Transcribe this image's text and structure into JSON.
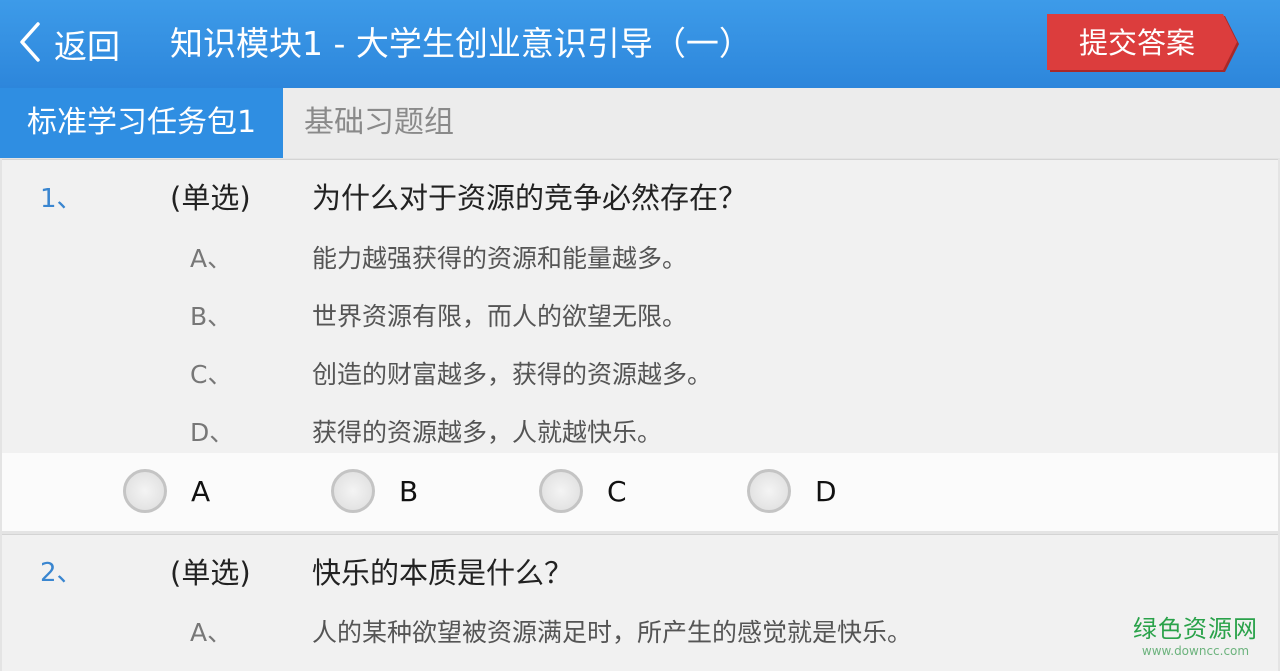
{
  "header": {
    "back_label": "返回",
    "title": "知识模块1 - 大学生创业意识引导（一）",
    "submit_label": "提交答案"
  },
  "tabs": [
    {
      "label": "标准学习任务包1",
      "active": true
    },
    {
      "label": "基础习题组",
      "active": false
    }
  ],
  "questions": [
    {
      "number": "1、",
      "type": "(单选)",
      "text": "为什么对于资源的竞争必然存在？",
      "options": [
        {
          "letter": "A、",
          "text": "能力越强获得的资源和能量越多。"
        },
        {
          "letter": "B、",
          "text": "世界资源有限，而人的欲望无限。"
        },
        {
          "letter": "C、",
          "text": "创造的财富越多，获得的资源越多。"
        },
        {
          "letter": "D、",
          "text": "获得的资源越多，人就越快乐。"
        }
      ],
      "answers": [
        "A",
        "B",
        "C",
        "D"
      ]
    },
    {
      "number": "2、",
      "type": "(单选)",
      "text": "快乐的本质是什么？",
      "options": [
        {
          "letter": "A、",
          "text": "人的某种欲望被资源满足时，所产生的感觉就是快乐。"
        }
      ]
    }
  ],
  "watermark": {
    "title": "绿色资源网",
    "url": "www.downcc.com"
  },
  "colors": {
    "header": "#2d86db",
    "active_tab": "#2f8ee2",
    "submit": "#d83a3a",
    "question_number": "#3a86d0"
  }
}
